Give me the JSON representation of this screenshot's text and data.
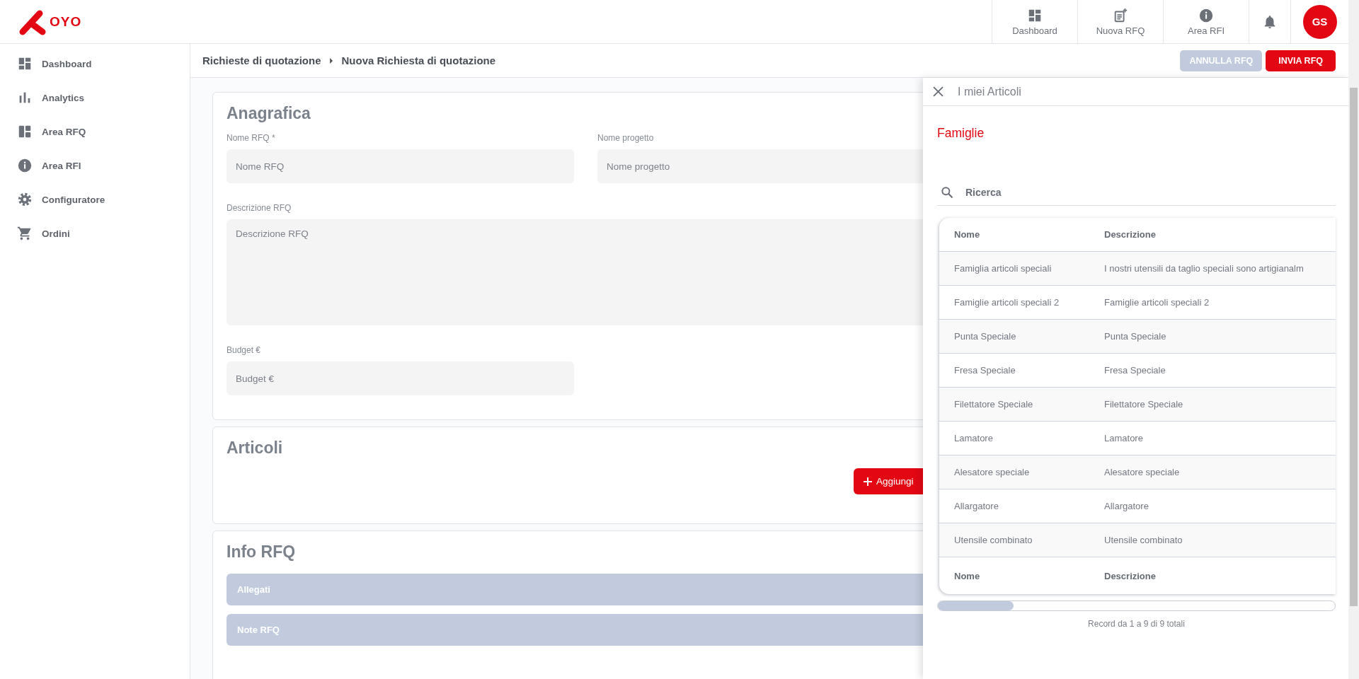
{
  "header": {
    "logo_text": "OYO",
    "nav": [
      {
        "label": "Dashboard"
      },
      {
        "label": "Nuova RFQ"
      },
      {
        "label": "Area RFI"
      }
    ],
    "avatar": "GS"
  },
  "sidebar": {
    "items": [
      {
        "label": "Dashboard"
      },
      {
        "label": "Analytics"
      },
      {
        "label": "Area RFQ"
      },
      {
        "label": "Area RFI"
      },
      {
        "label": "Configuratore"
      },
      {
        "label": "Ordini"
      }
    ]
  },
  "breadcrumb": [
    "Richieste di quotazione",
    "Nuova Richiesta di quotazione"
  ],
  "actions": [
    {
      "label": "ANNULLA RFQ",
      "disabled": true
    },
    {
      "label": "INVIA RFQ",
      "disabled": false
    }
  ],
  "anagrafica": {
    "title": "Anagrafica",
    "fields": [
      {
        "label": "Nome RFQ *",
        "placeholder": "Nome RFQ",
        "kind": "input"
      },
      {
        "label": "Nome progetto",
        "placeholder": "Nome progetto",
        "kind": "input"
      },
      {
        "label": "Descrizione RFQ",
        "placeholder": "Descrizione RFQ",
        "kind": "textarea"
      },
      {
        "label": "Budget €",
        "placeholder": "Budget €",
        "kind": "input"
      }
    ]
  },
  "articoli": {
    "title": "Articoli",
    "add_button": "Aggiungi"
  },
  "info_rfq": {
    "title": "Info RFQ",
    "panels": [
      "Allegati",
      "Note RFQ"
    ]
  },
  "drawer": {
    "title": "I miei Articoli",
    "section": "Famiglie",
    "search": {
      "placeholder": "Ricerca"
    },
    "table": {
      "columns": [
        "Nome",
        "Descrizione"
      ],
      "rows": [
        [
          "Famiglia articoli speciali",
          "I nostri utensili da taglio speciali sono artigianalm"
        ],
        [
          "Famiglie articoli speciali 2",
          "Famiglie articoli speciali 2"
        ],
        [
          "Punta Speciale",
          "Punta Speciale"
        ],
        [
          "Fresa Speciale",
          "Fresa Speciale"
        ],
        [
          "Filettatore Speciale",
          "Filettatore Speciale"
        ],
        [
          "Lamatore",
          "Lamatore"
        ],
        [
          "Alesatore speciale",
          "Alesatore speciale"
        ],
        [
          "Allargatore",
          "Allargatore"
        ],
        [
          "Utensile combinato",
          "Utensile combinato"
        ]
      ],
      "footer": [
        "Nome",
        "Descrizione"
      ]
    },
    "record_count": "Record da 1 a 9 di 9 totali"
  }
}
